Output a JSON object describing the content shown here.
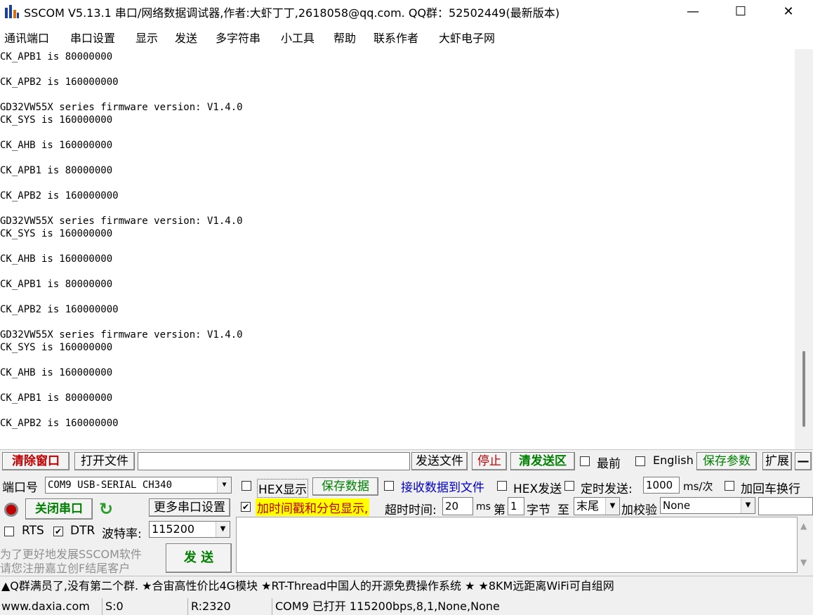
{
  "window": {
    "title": "SSCOM V5.13.1 串口/网络数据调试器,作者:大虾丁丁,2618058@qq.com. QQ群：52502449(最新版本)",
    "minimize_glyph": "—",
    "maximize_glyph": "☐",
    "close_glyph": "✕"
  },
  "menu": [
    "通讯端口",
    "串口设置",
    "显示",
    "发送",
    "多字符串",
    "小工具",
    "帮助",
    "联系作者",
    "大虾电子网"
  ],
  "receive": {
    "lines": [
      "CK_APB1 is 80000000",
      "",
      "CK_APB2 is 160000000",
      "",
      "GD32VW55X series firmware version: V1.4.0",
      "CK_SYS is 160000000",
      "",
      "CK_AHB is 160000000",
      "",
      "CK_APB1 is 80000000",
      "",
      "CK_APB2 is 160000000",
      "",
      "GD32VW55X series firmware version: V1.4.0",
      "CK_SYS is 160000000",
      "",
      "CK_AHB is 160000000",
      "",
      "CK_APB1 is 80000000",
      "",
      "CK_APB2 is 160000000",
      "",
      "GD32VW55X series firmware version: V1.4.0",
      "CK_SYS is 160000000",
      "",
      "CK_AHB is 160000000",
      "",
      "CK_APB1 is 80000000",
      "",
      "CK_APB2 is 160000000"
    ]
  },
  "toolbar": {
    "clear_window": "清除窗口",
    "open_file": "打开文件",
    "file_path": "",
    "send_file": "发送文件",
    "stop": "停止",
    "clear_send": "清发送区",
    "topmost": "最前",
    "english": "English",
    "save_params": "保存参数",
    "expand": "扩展",
    "collapse": "—"
  },
  "port": {
    "port_label": "端口号",
    "port_value": "COM9 USB-SERIAL CH340",
    "close_port": "关闭串口",
    "more_settings": "更多串口设置",
    "rts": "RTS",
    "dtr": "DTR",
    "baud_label": "波特率:",
    "baud_value": "115200",
    "promo_line1": "为了更好地发展SSCOM软件",
    "promo_line2": "请您注册嘉立创F结尾客户",
    "send": "发  送"
  },
  "options": {
    "hex_display": "HEX显示",
    "save_data": "保存数据",
    "recv_to_file": "接收数据到文件",
    "hex_send": "HEX发送",
    "timed_send": "定时发送:",
    "timed_value": "1000",
    "timed_unit": "ms/次",
    "add_crlf": "加回车换行",
    "timestamp": "加时间戳和分包显示,",
    "timeout_label": "超时时间:",
    "timeout_value": "20",
    "timeout_unit": "ms",
    "byte_prefix": "第",
    "byte_index": "1",
    "byte_label": "字节",
    "to_label": "至",
    "to_value": "末尾",
    "checksum_label": "加校验",
    "checksum_value": "None"
  },
  "ad_bar": "▲Q群满员了,没有第二个群. ★合宙高性价比4G模块 ★RT-Thread中国人的开源免费操作系统 ★ ★8KM远距离WiFi可自组网",
  "status": {
    "website": "www.daxia.com",
    "sent": "S:0",
    "received": "R:2320",
    "port_status": "COM9 已打开  115200bps,8,1,None,None"
  },
  "colors": {
    "accent_red": "#c00000",
    "accent_green": "#008000",
    "accent_blue": "#0000c8",
    "highlight_yellow": "#ffff00"
  }
}
